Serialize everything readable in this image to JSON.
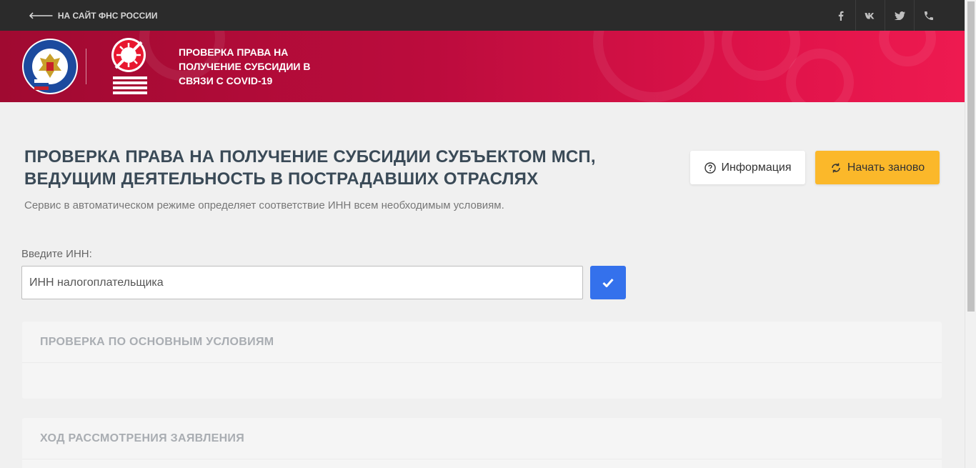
{
  "topbar": {
    "back_label": "НА САЙТ ФНС РОССИИ",
    "social": [
      {
        "name": "facebook-icon",
        "glyph": "f"
      },
      {
        "name": "vk-icon",
        "glyph": "vk"
      },
      {
        "name": "twitter-icon",
        "glyph": ""
      },
      {
        "name": "phone-icon",
        "glyph": ""
      }
    ]
  },
  "banner": {
    "title": "ПРОВЕРКА ПРАВА НА ПОЛУЧЕНИЕ СУБСИДИИ В СВЯЗИ С COVID-19",
    "emblem_text": "ФЕДЕРАЛЬНАЯ НАЛОГОВАЯ СЛУЖБА"
  },
  "main": {
    "title": "ПРОВЕРКА ПРАВА НА ПОЛУЧЕНИЕ СУБСИДИИ СУБЪЕКТОМ МСП, ВЕДУЩИМ ДЕЯТЕЛЬНОСТЬ В ПОСТРАДАВШИХ ОТРАСЛЯХ",
    "subtitle": "Сервис в автоматическом режиме определяет соответствие ИНН всем необходимым условиям.",
    "info_button": "Информация",
    "restart_button": "Начать заново",
    "inn_label": "Введите ИНН:",
    "inn_placeholder": "ИНН налогоплательщика",
    "inn_value": ""
  },
  "panels": [
    {
      "title": "ПРОВЕРКА ПО ОСНОВНЫМ УСЛОВИЯМ"
    },
    {
      "title": "ХОД РАССМОТРЕНИЯ ЗАЯВЛЕНИЯ"
    }
  ],
  "colors": {
    "topbar": "#2b2b2b",
    "banner_start": "#a00a31",
    "banner_end": "#ee1a50",
    "accent_blue": "#3471ec",
    "accent_yellow": "#fbb82a"
  }
}
